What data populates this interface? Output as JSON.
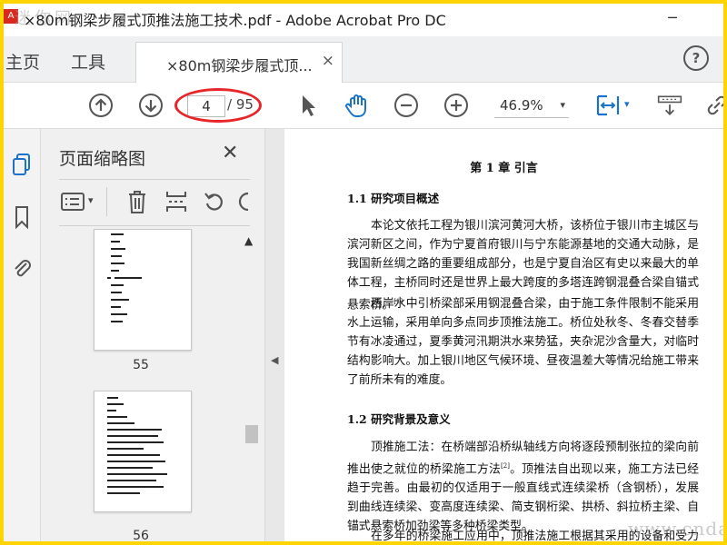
{
  "window": {
    "title": "×80m钢梁步履式顶推法施工技术.pdf - Adobe Acrobat Pro DC",
    "icon_letter": "A",
    "minimize_icon": "─",
    "watermark_top": "迷你网"
  },
  "tabs": {
    "home": "主页",
    "tools": "工具",
    "doc_tab": "×80m钢梁步履式顶...",
    "doc_tab_close": "×",
    "help": "?"
  },
  "toolbar": {
    "current_page": "4",
    "total_pages": "/ 95",
    "zoom": "46.9%",
    "zoom_arrow": "▾",
    "fit_arrow": "▾"
  },
  "panel": {
    "title": "页面缩略图",
    "close": "✕",
    "options_arrow": "▾",
    "scroll_up": "▲",
    "thumbnails": [
      {
        "label": "55"
      },
      {
        "label": "56"
      }
    ]
  },
  "splitter": {
    "arrow": "◀"
  },
  "document": {
    "chapter_title": "第 1 章  引言",
    "sec1_title": "1.1 研究项目概述",
    "sec1_p1": "本论文依托工程为银川滨河黄河大桥，该桥位于银川市主城区与滨河新区之间，作为宁夏首府银川与宁东能源基地的交通大动脉，是我国新丝绸之路的重要组成部分，也是宁夏自治区有史以来最大的单体工程，主桥同时还是世界上最大跨度的多塔连跨钢混叠合梁自锚式悬索桥。",
    "sec1_p1_ref": "[1]",
    "sec1_p2": "西岸水中引桥梁部采用钢混叠合梁，由于施工条件限制不能采用水上运输，采用单向多点同步顶推法施工。桥位处秋冬、冬春交替季节有冰凌通过，夏季黄河汛期洪水来势猛，夹杂泥沙含量大，对临时结构影响大。加上银川地区气候环境、昼夜温差大等情况给施工带来了前所未有的难度。",
    "sec2_title": "1.2 研究背景及意义",
    "sec2_p1_a": "顶推施工法：在桥端部沿桥纵轴线方向将逐段预制张拉的梁向前推出使之就位的桥梁施工方法",
    "sec2_p1_ref": "[2]",
    "sec2_p1_b": "。顶推法自出现以来，施工方法已经趋于完善。由最初的仅适用于一般直线式连续梁桥（含钢桥），发展到曲线连续梁、变高度连续梁、简支钢桁梁、拱桥、斜拉桥主梁、自锚式悬索桥加劲梁等多种桥梁类型。",
    "sec2_p2": "在多年的桥梁施工应用中，顶推法施工根据其采用的设备和受力原",
    "watermark": "www.cndao.com"
  },
  "colors": {
    "frame": "#ffd400",
    "highlight_ellipse": "#e8262a",
    "icon_blue": "#1a73c8",
    "icon_gray": "#555555"
  }
}
